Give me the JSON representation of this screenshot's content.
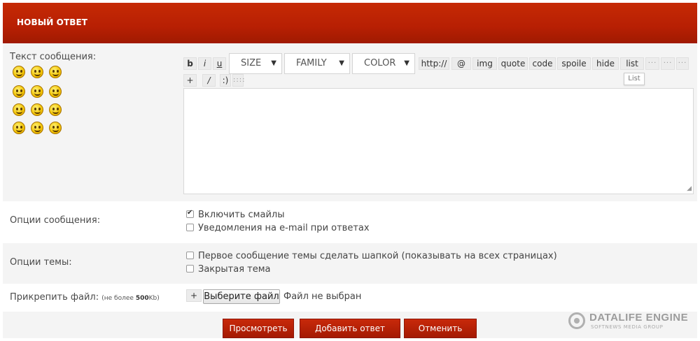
{
  "header": {
    "title": "НОВЫЙ ОТВЕТ"
  },
  "message": {
    "label": "Текст сообщения:",
    "smiles": [
      "angry",
      "laugh",
      "cool",
      "scared",
      "smile-closed",
      "smile",
      "sad",
      "happy",
      "surprised",
      "tongue",
      "wink",
      "sleepy"
    ]
  },
  "toolbar": {
    "bold": "b",
    "italic": "i",
    "underline": "u",
    "size": "SIZE",
    "family": "FAMILY",
    "color": "COLOR",
    "link": "http://",
    "email": "@",
    "img": "img",
    "quote": "quote",
    "code": "code",
    "spoiler": "spoile",
    "hide": "hide",
    "list": "list",
    "dots1": "···",
    "dots2": "···",
    "dots3": "···",
    "plus": "+",
    "slash": "/",
    "smiley": ":)",
    "dots4": "::::",
    "tooltip": "List"
  },
  "options": {
    "message_label": "Опции сообщения:",
    "smiles_label": "Включить смайлы",
    "smiles_checked": true,
    "notify_label": "Уведомления на e-mail при ответах",
    "notify_checked": false,
    "topic_label": "Опции темы:",
    "sticky_label": "Первое сообщение темы сделать шапкой (показывать на всех страницах)",
    "sticky_checked": false,
    "closed_label": "Закрытая тема",
    "closed_checked": false
  },
  "attach": {
    "label": "Прикрепить файл:",
    "hint_prefix": "(не более ",
    "hint_size": "500",
    "hint_suffix": "Kb)",
    "plus": "+",
    "choose": "Выберите файл",
    "status": "Файл не выбран"
  },
  "actions": {
    "preview": "Просмотреть",
    "submit": "Добавить ответ",
    "cancel": "Отменить"
  },
  "brand": {
    "name": "DATALIFE ENGINE",
    "sub": "SOFTNEWS MEDIA GROUP"
  },
  "colors": {
    "accent": "#b82004"
  }
}
